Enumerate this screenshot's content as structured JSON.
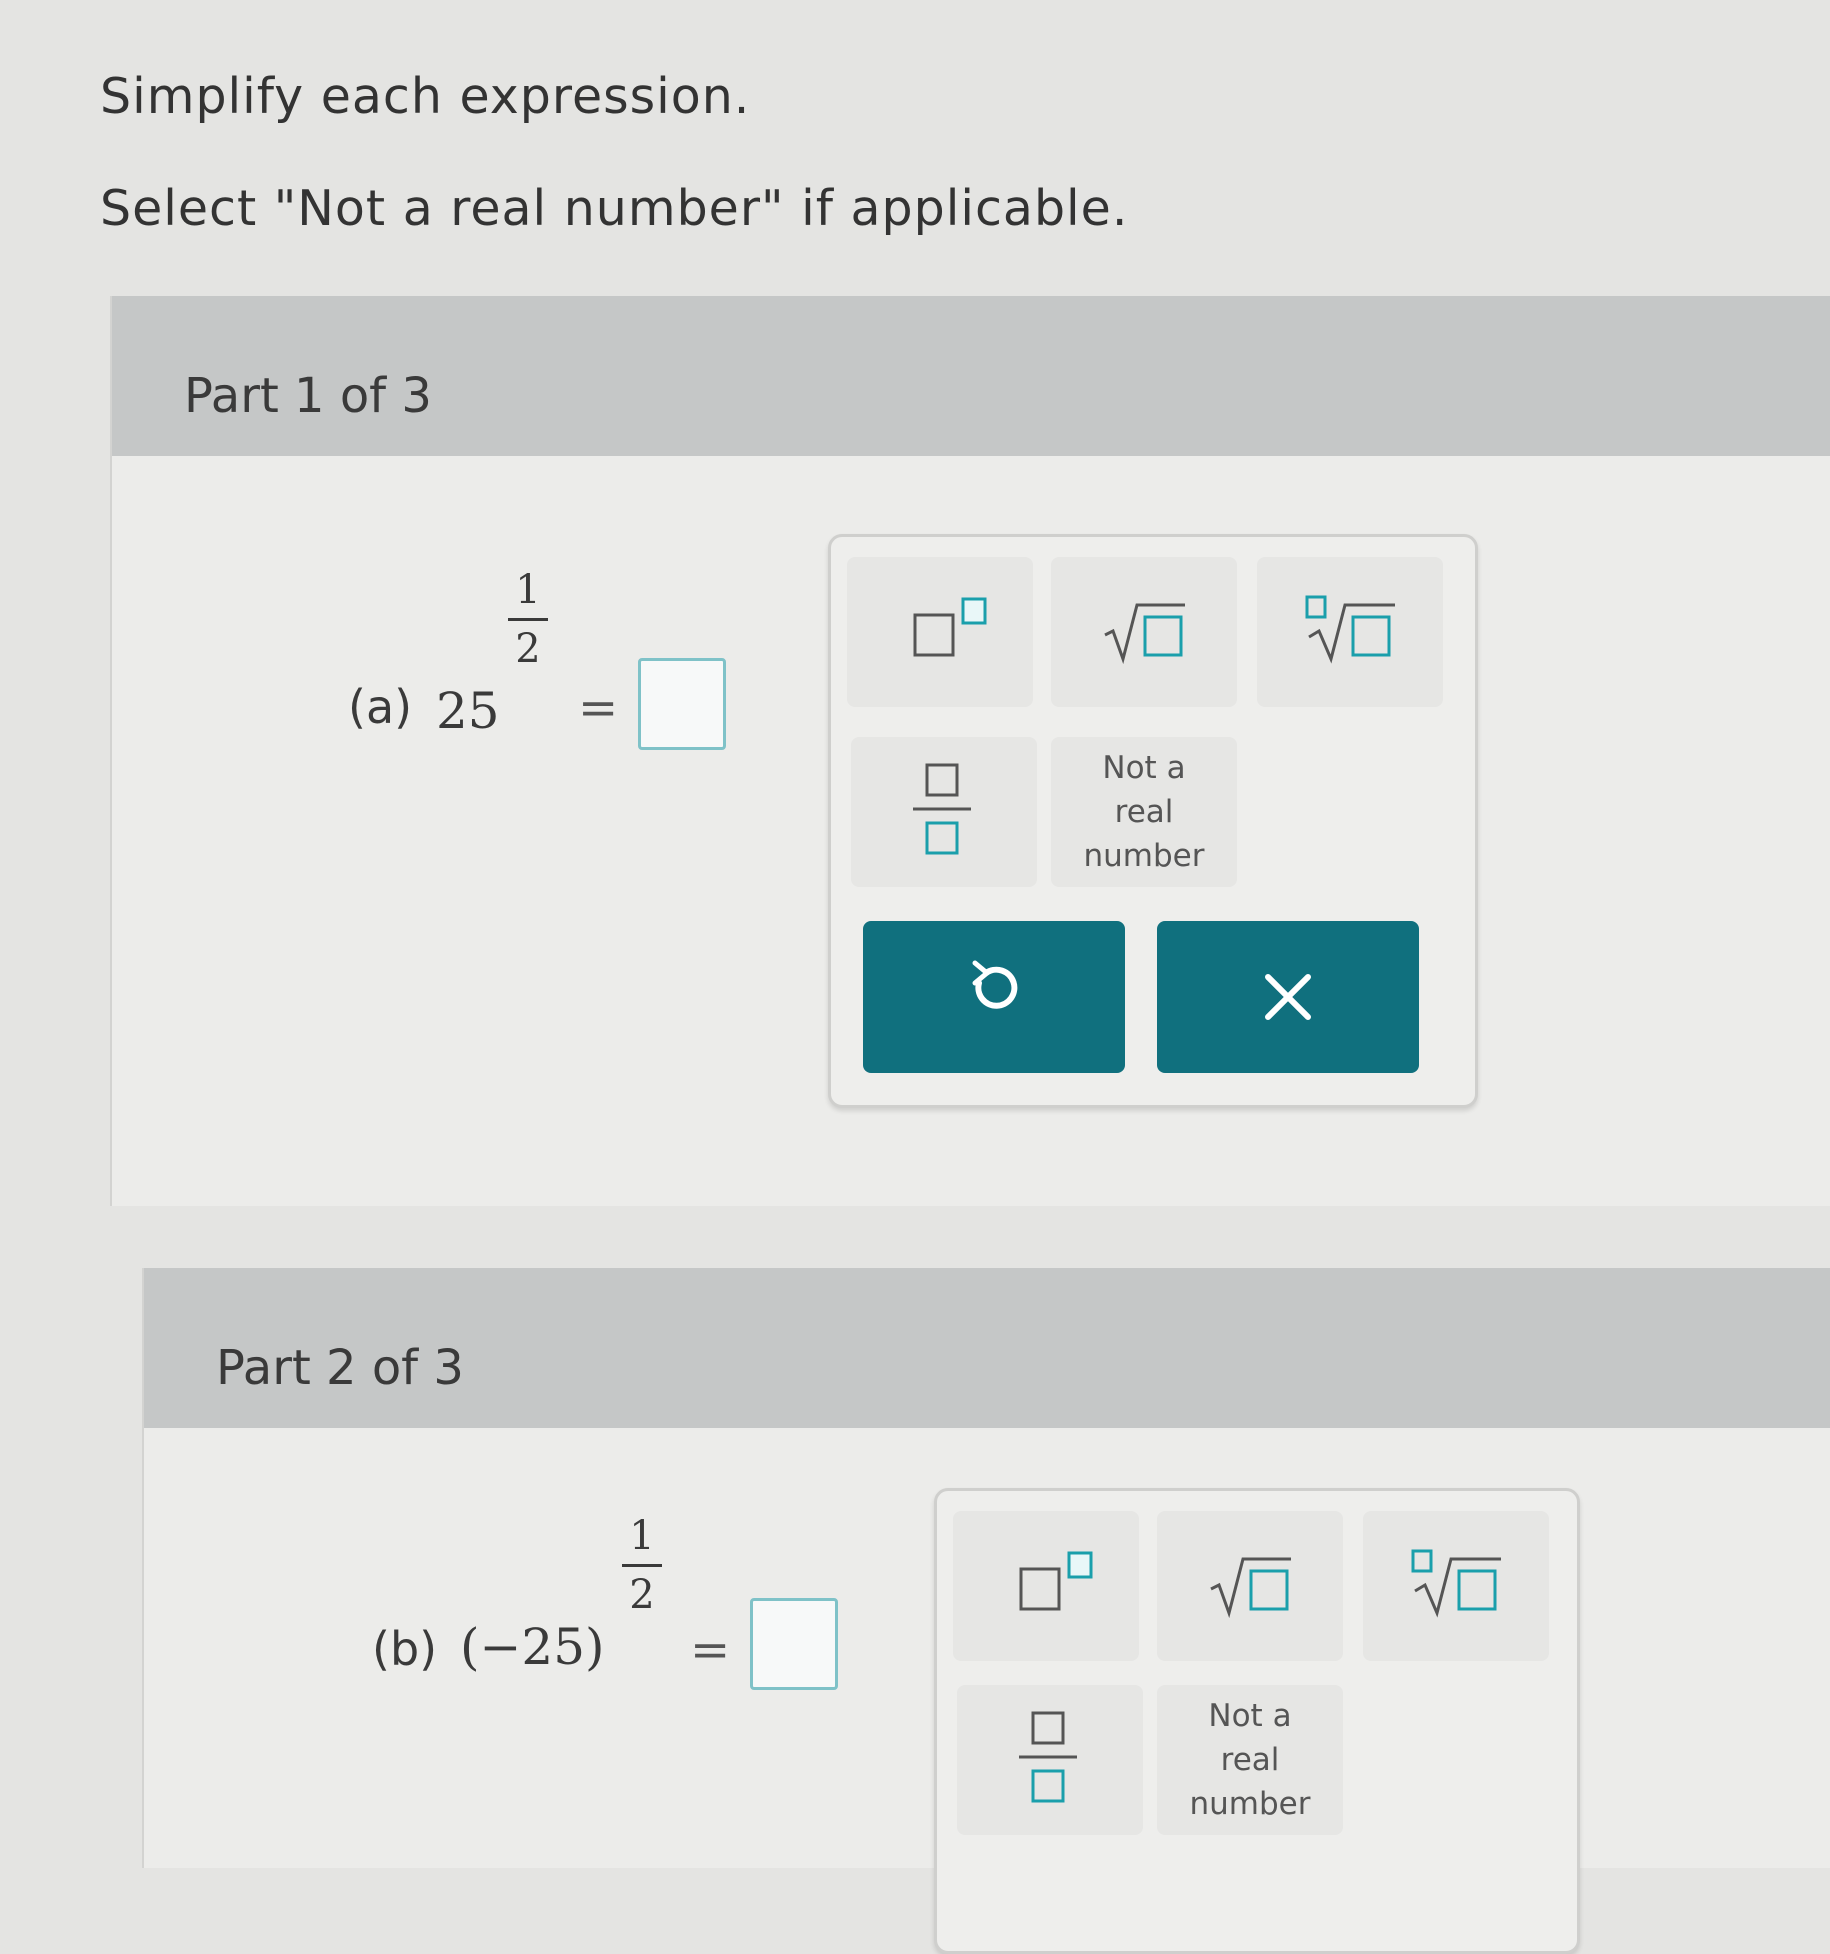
{
  "instructions": {
    "line1": "Simplify each expression.",
    "line2": "Select \"Not a real number\" if applicable."
  },
  "parts": [
    {
      "header": "Part 1 of 3",
      "problem": {
        "label": "(a)",
        "base": "25",
        "exp_num": "1",
        "exp_den": "2",
        "equals": "="
      }
    },
    {
      "header": "Part 2 of 3",
      "problem": {
        "label": "(b)",
        "base": "(−25)",
        "exp_num": "1",
        "exp_den": "2",
        "equals": "="
      }
    }
  ],
  "keypad": {
    "keys": [
      "superscript-template",
      "square-root-template",
      "nth-root-template",
      "fraction-template"
    ],
    "not_real_label": "Not a\nreal\nnumber",
    "actions": [
      "undo-icon",
      "clear-icon"
    ]
  },
  "colors": {
    "accent": "#10707e",
    "answer_box_border": "#7fc2c8",
    "header_bg": "#c5c7c7"
  }
}
